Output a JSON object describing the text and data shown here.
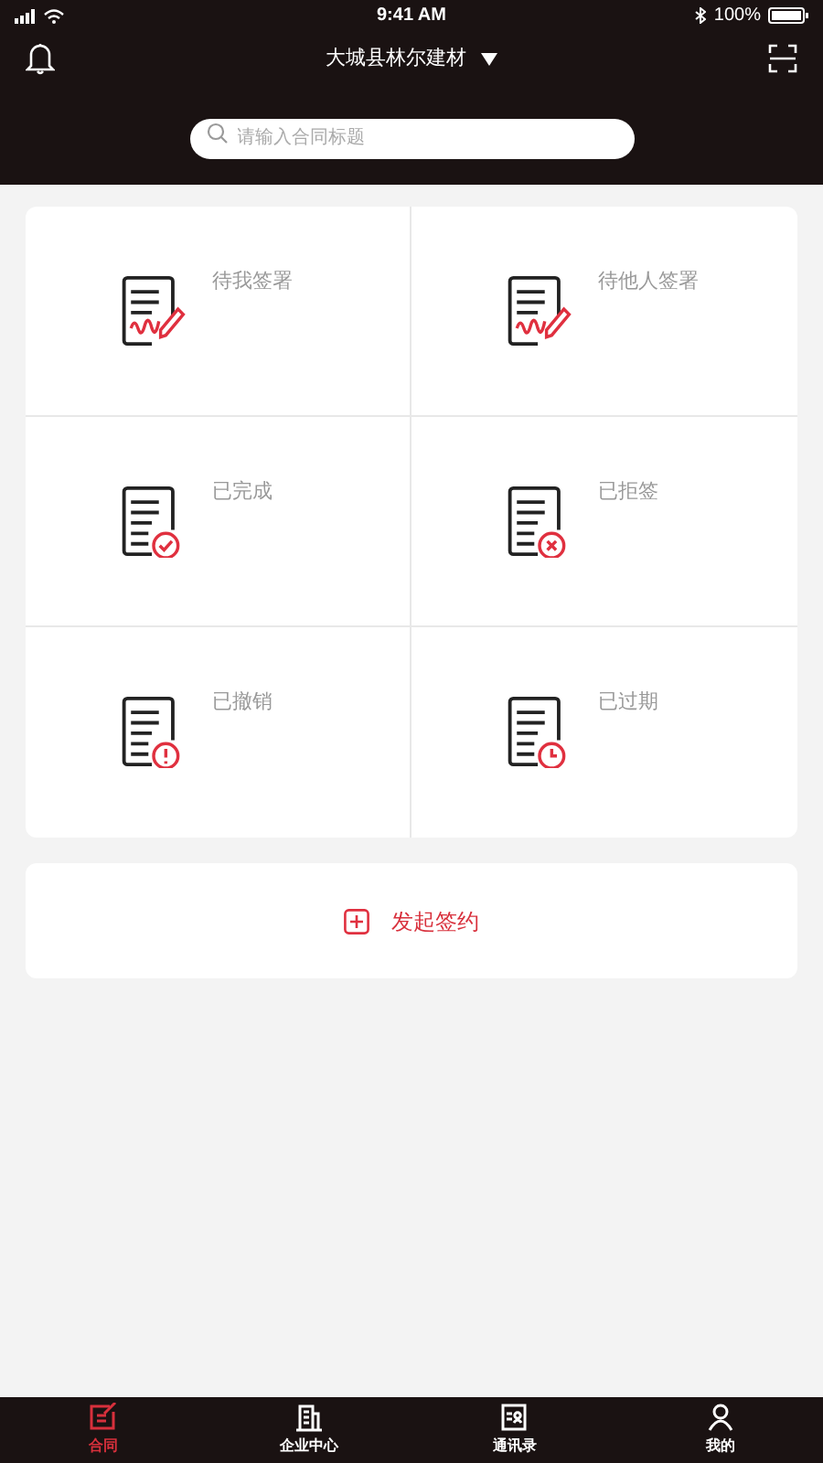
{
  "status_bar": {
    "time": "9:41 AM",
    "battery": "100%"
  },
  "header": {
    "company": "大城县林尔建材",
    "search": {
      "placeholder": "请输入合同标题"
    }
  },
  "tiles": [
    {
      "label": "待我签署",
      "kind": "sign"
    },
    {
      "label": "待他人签署",
      "kind": "sign"
    },
    {
      "label": "已完成",
      "kind": "done"
    },
    {
      "label": "已拒签",
      "kind": "rejected"
    },
    {
      "label": "已撤销",
      "kind": "revoked"
    },
    {
      "label": "已过期",
      "kind": "expired"
    }
  ],
  "new_contract": {
    "label": "发起签约"
  },
  "tab_bar": [
    {
      "label": "合同",
      "kind": "contract",
      "selected": true
    },
    {
      "label": "企业中心",
      "kind": "company",
      "selected": false
    },
    {
      "label": "通讯录",
      "kind": "contacts",
      "selected": false
    },
    {
      "label": "我的",
      "kind": "me",
      "selected": false
    }
  ]
}
